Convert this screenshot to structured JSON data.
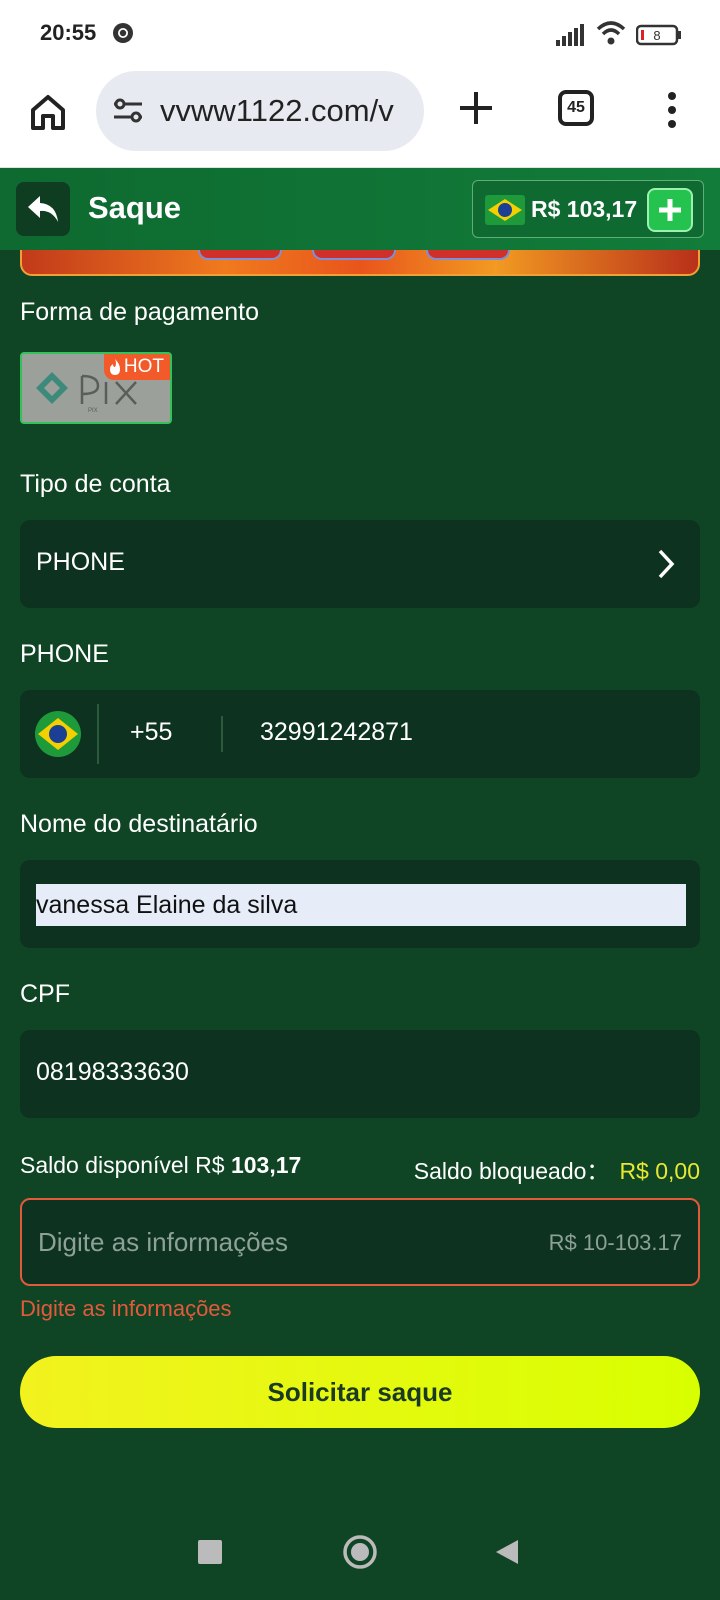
{
  "status": {
    "time": "20:55",
    "battery": "8"
  },
  "browser": {
    "url": "vvww1122.com/v",
    "tab_count": "45"
  },
  "header": {
    "title": "Saque",
    "balance": "R$ 103,17"
  },
  "payment": {
    "label": "Forma de pagamento",
    "badge": "HOT",
    "method": "PIX"
  },
  "account_type": {
    "label": "Tipo de conta",
    "value": "PHONE"
  },
  "phone": {
    "label": "PHONE",
    "country_code": "+55",
    "number": "32991242871"
  },
  "recipient": {
    "label": "Nome do destinatário",
    "value": "vanessa Elaine da silva"
  },
  "cpf": {
    "label": "CPF",
    "value": "08198333630"
  },
  "balances": {
    "available_label": "Saldo disponível R$",
    "available_value": "103,17",
    "blocked_label": "Saldo bloqueado：",
    "blocked_value": "R$ 0,00"
  },
  "amount": {
    "placeholder": "Digite as informações",
    "range": "R$ 10-103.17",
    "error": "Digite as informações"
  },
  "submit_label": "Solicitar saque",
  "colors": {
    "accent": "#e8ff00",
    "error": "#e25a3c",
    "bg": "#0f4424"
  }
}
